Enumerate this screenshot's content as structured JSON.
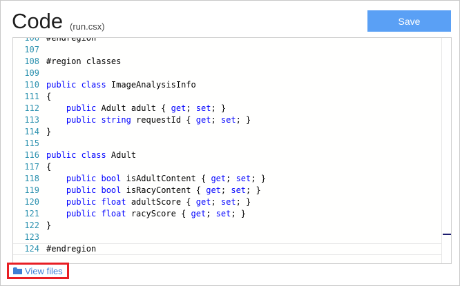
{
  "header": {
    "title": "Code",
    "subtitle": "(run.csx)",
    "save_label": "Save"
  },
  "editor": {
    "lines": [
      {
        "num": "106",
        "segments": [
          {
            "t": "#endregion",
            "k": false
          }
        ]
      },
      {
        "num": "107",
        "segments": []
      },
      {
        "num": "108",
        "segments": [
          {
            "t": "#region classes",
            "k": false
          }
        ]
      },
      {
        "num": "109",
        "segments": []
      },
      {
        "num": "110",
        "segments": [
          {
            "t": "public class",
            "k": true
          },
          {
            "t": " ImageAnalysisInfo",
            "k": false
          }
        ]
      },
      {
        "num": "111",
        "segments": [
          {
            "t": "{",
            "k": false
          }
        ]
      },
      {
        "num": "112",
        "segments": [
          {
            "t": "    ",
            "k": false
          },
          {
            "t": "public",
            "k": true
          },
          {
            "t": " Adult adult { ",
            "k": false
          },
          {
            "t": "get",
            "k": true
          },
          {
            "t": "; ",
            "k": false
          },
          {
            "t": "set",
            "k": true
          },
          {
            "t": "; }",
            "k": false
          }
        ]
      },
      {
        "num": "113",
        "segments": [
          {
            "t": "    ",
            "k": false
          },
          {
            "t": "public string",
            "k": true
          },
          {
            "t": " requestId { ",
            "k": false
          },
          {
            "t": "get",
            "k": true
          },
          {
            "t": "; ",
            "k": false
          },
          {
            "t": "set",
            "k": true
          },
          {
            "t": "; }",
            "k": false
          }
        ]
      },
      {
        "num": "114",
        "segments": [
          {
            "t": "}",
            "k": false
          }
        ]
      },
      {
        "num": "115",
        "segments": []
      },
      {
        "num": "116",
        "segments": [
          {
            "t": "public class",
            "k": true
          },
          {
            "t": " Adult",
            "k": false
          }
        ]
      },
      {
        "num": "117",
        "segments": [
          {
            "t": "{",
            "k": false
          }
        ]
      },
      {
        "num": "118",
        "segments": [
          {
            "t": "    ",
            "k": false
          },
          {
            "t": "public bool",
            "k": true
          },
          {
            "t": " isAdultContent { ",
            "k": false
          },
          {
            "t": "get",
            "k": true
          },
          {
            "t": "; ",
            "k": false
          },
          {
            "t": "set",
            "k": true
          },
          {
            "t": "; }",
            "k": false
          }
        ]
      },
      {
        "num": "119",
        "segments": [
          {
            "t": "    ",
            "k": false
          },
          {
            "t": "public bool",
            "k": true
          },
          {
            "t": " isRacyContent { ",
            "k": false
          },
          {
            "t": "get",
            "k": true
          },
          {
            "t": "; ",
            "k": false
          },
          {
            "t": "set",
            "k": true
          },
          {
            "t": "; }",
            "k": false
          }
        ]
      },
      {
        "num": "120",
        "segments": [
          {
            "t": "    ",
            "k": false
          },
          {
            "t": "public float",
            "k": true
          },
          {
            "t": " adultScore { ",
            "k": false
          },
          {
            "t": "get",
            "k": true
          },
          {
            "t": "; ",
            "k": false
          },
          {
            "t": "set",
            "k": true
          },
          {
            "t": "; }",
            "k": false
          }
        ]
      },
      {
        "num": "121",
        "segments": [
          {
            "t": "    ",
            "k": false
          },
          {
            "t": "public float",
            "k": true
          },
          {
            "t": " racyScore { ",
            "k": false
          },
          {
            "t": "get",
            "k": true
          },
          {
            "t": "; ",
            "k": false
          },
          {
            "t": "set",
            "k": true
          },
          {
            "t": "; }",
            "k": false
          }
        ]
      },
      {
        "num": "122",
        "segments": [
          {
            "t": "}",
            "k": false
          }
        ]
      },
      {
        "num": "123",
        "segments": []
      },
      {
        "num": "124",
        "segments": [
          {
            "t": "#endregion",
            "k": false
          }
        ],
        "current": true
      }
    ]
  },
  "footer": {
    "view_files_label": "View files",
    "view_files_icon": "folder-icon"
  },
  "colors": {
    "save_button": "#5aa0f5",
    "line_number": "#2b91af",
    "keyword": "#0000ff",
    "highlight_border": "#e81e24",
    "link": "#3d7fd6"
  }
}
